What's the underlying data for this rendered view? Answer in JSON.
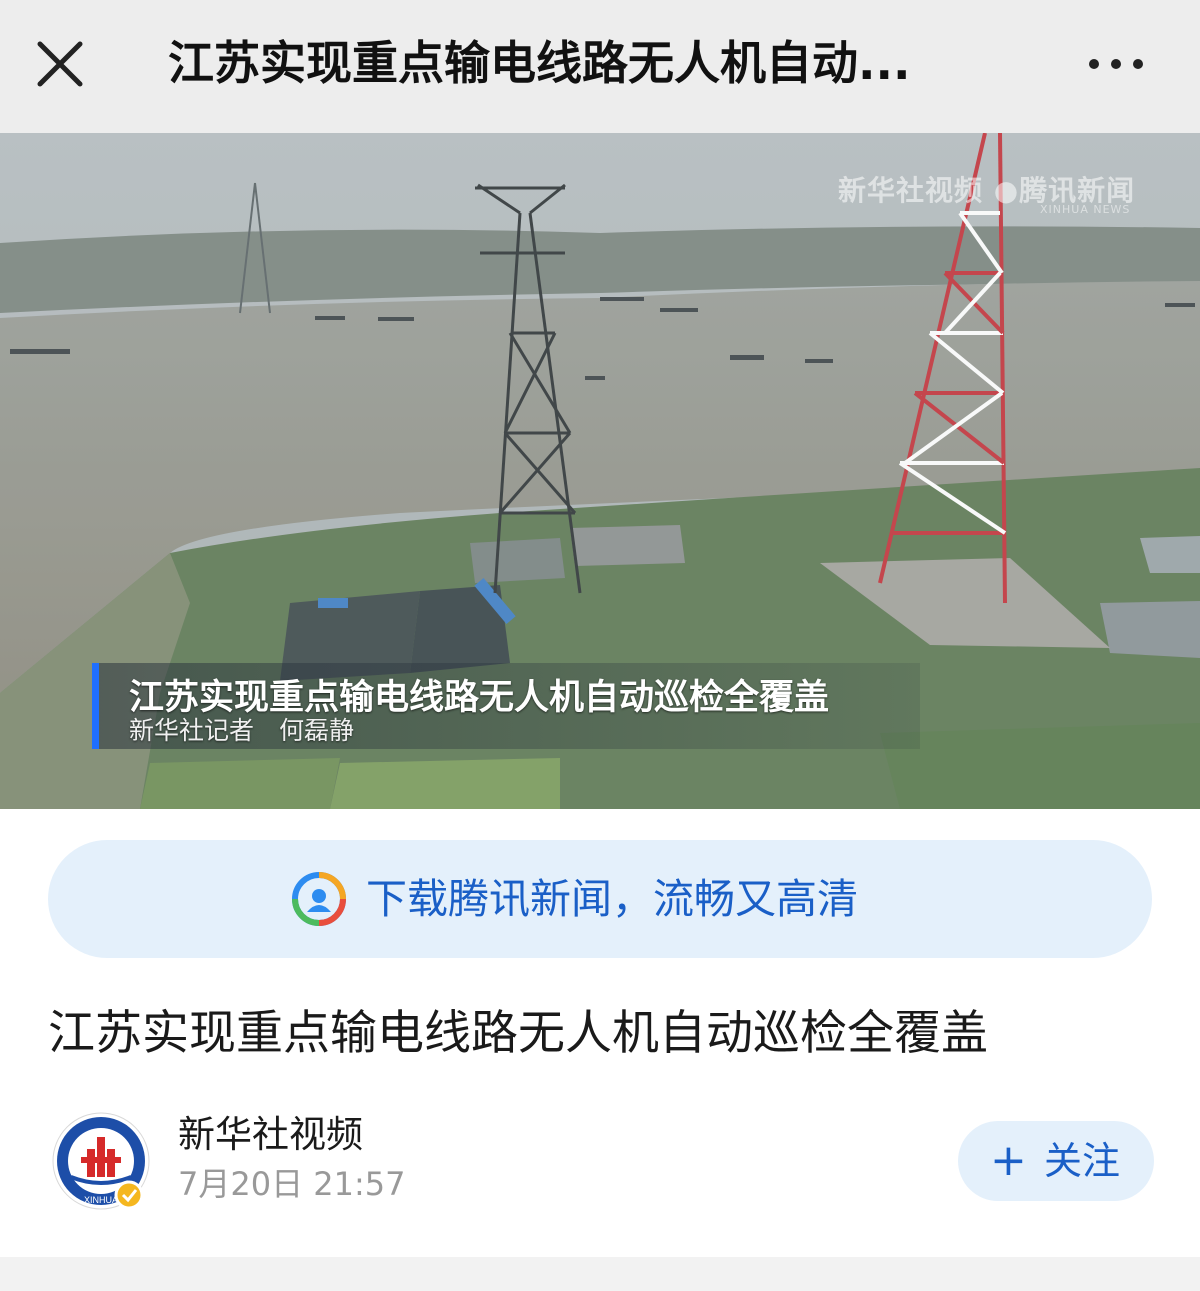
{
  "topbar": {
    "title": "江苏实现重点输电线路无人机自动...",
    "close_icon": "close-icon",
    "more_icon": "more-horizontal-icon"
  },
  "video": {
    "watermark": "新华社视频 ●腾讯新闻",
    "watermark_sub": "XINHUA NEWS",
    "caption_title": "江苏实现重点输电线路无人机自动巡检全覆盖",
    "caption_sub": "新华社记者　何磊静"
  },
  "download_banner": {
    "icon": "tencent-news-logo-icon",
    "text": "下载腾讯新闻，流畅又高清"
  },
  "article": {
    "title": "江苏实现重点输电线路无人机自动巡检全覆盖"
  },
  "author": {
    "name": "新华社视频",
    "publish_time": "7月20日 21:57",
    "avatar_text": "XINHUA",
    "verified_icon": "verified-badge-icon"
  },
  "follow": {
    "plus": "+",
    "label": "关注"
  },
  "colors": {
    "accent": "#1a5fc7",
    "banner_bg": "#e4f0fb",
    "topbar_bg": "#ededed",
    "caption_bar": "#1f6fff"
  }
}
